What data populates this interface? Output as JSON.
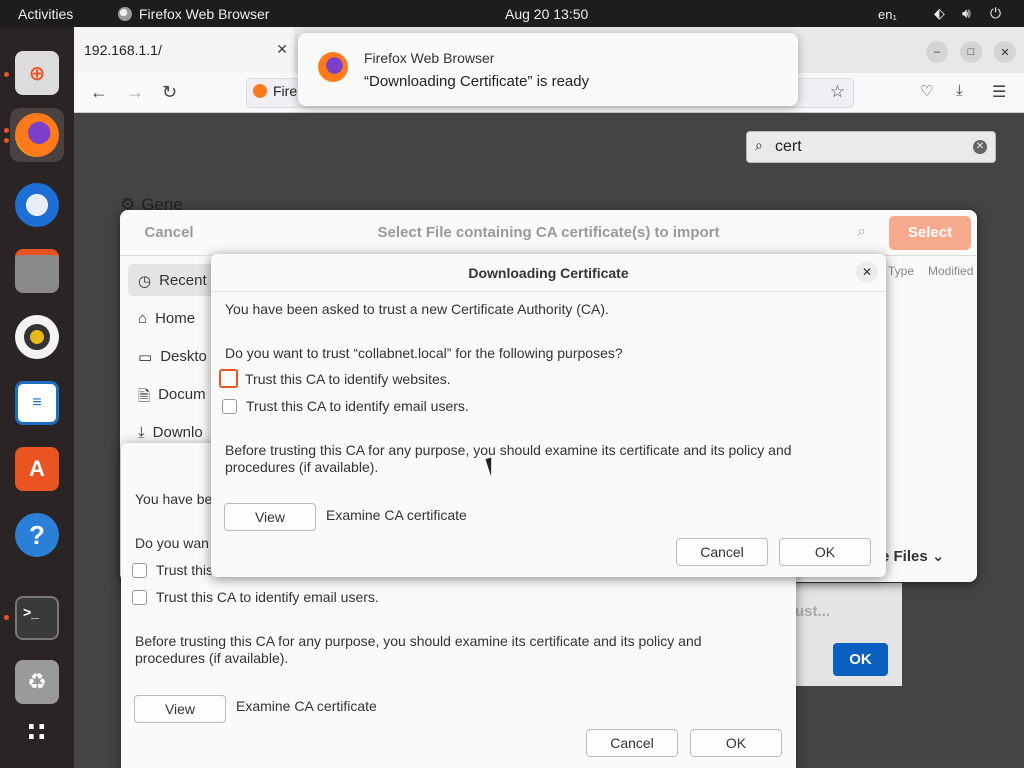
{
  "topbar": {
    "activities": "Activities",
    "app_name": "Firefox Web Browser",
    "clock": "Aug 20  13:50",
    "lang": "en₁"
  },
  "dock": {
    "apps": [
      {
        "name": "help-rescue",
        "color": "#dcdcdc"
      },
      {
        "name": "firefox",
        "color": "#ff7a1a"
      },
      {
        "name": "thunderbird",
        "color": "#1d6fd6"
      },
      {
        "name": "files",
        "color": "#7a7a7a"
      },
      {
        "name": "rhythmbox",
        "color": "#f0c020"
      },
      {
        "name": "libreoffice-writer",
        "color": "#1e6fc4"
      },
      {
        "name": "app-center",
        "color": "#e95420"
      },
      {
        "name": "help",
        "color": "#2a7fd6"
      },
      {
        "name": "terminal",
        "color": "#3a3a3a"
      },
      {
        "name": "trash",
        "color": "#8a8a8a"
      },
      {
        "name": "show-apps",
        "color": "#2a2424"
      }
    ]
  },
  "browser": {
    "tab_title": "192.168.1.1/",
    "url_chip": "Fire",
    "find_query": "cert",
    "settings_section": "Gene"
  },
  "notification": {
    "app": "Firefox Web Browser",
    "body": "“Downloading Certificate” is ready"
  },
  "file_chooser": {
    "cancel": "Cancel",
    "title": "Select File containing CA certificate(s) to import",
    "select": "Select",
    "sidebar": [
      "Recent",
      "Home",
      "Deskto",
      "Docum",
      "Downlo"
    ],
    "columns": [
      "Type",
      "Modified"
    ],
    "filter": "te Files"
  },
  "dialog_front": {
    "title": "Downloading Certificate",
    "line1": "You have been asked to trust a new Certificate Authority (CA).",
    "line2": "Do you want to trust “collabnet.local” for the following purposes?",
    "cb1": "Trust this CA to identify websites.",
    "cb2": "Trust this CA to identify email users.",
    "para": "Before trusting this CA for any purpose, you should examine its certificate and its policy and procedures (if available).",
    "view": "View",
    "examine": "Examine CA certificate",
    "cancel": "Cancel",
    "ok": "OK"
  },
  "dialog_back": {
    "line1": "You have be",
    "line2": "Do you wan",
    "cb1": "Trust this",
    "cb2": "Trust this CA to identify email users.",
    "para": "Before trusting this CA for any purpose, you should examine its certificate and its policy and procedures (if available).",
    "view": "View",
    "examine": "Examine CA certificate",
    "cancel": "Cancel",
    "ok": "OK"
  },
  "dialog_far": {
    "trust": "ust...",
    "ok": "OK"
  }
}
